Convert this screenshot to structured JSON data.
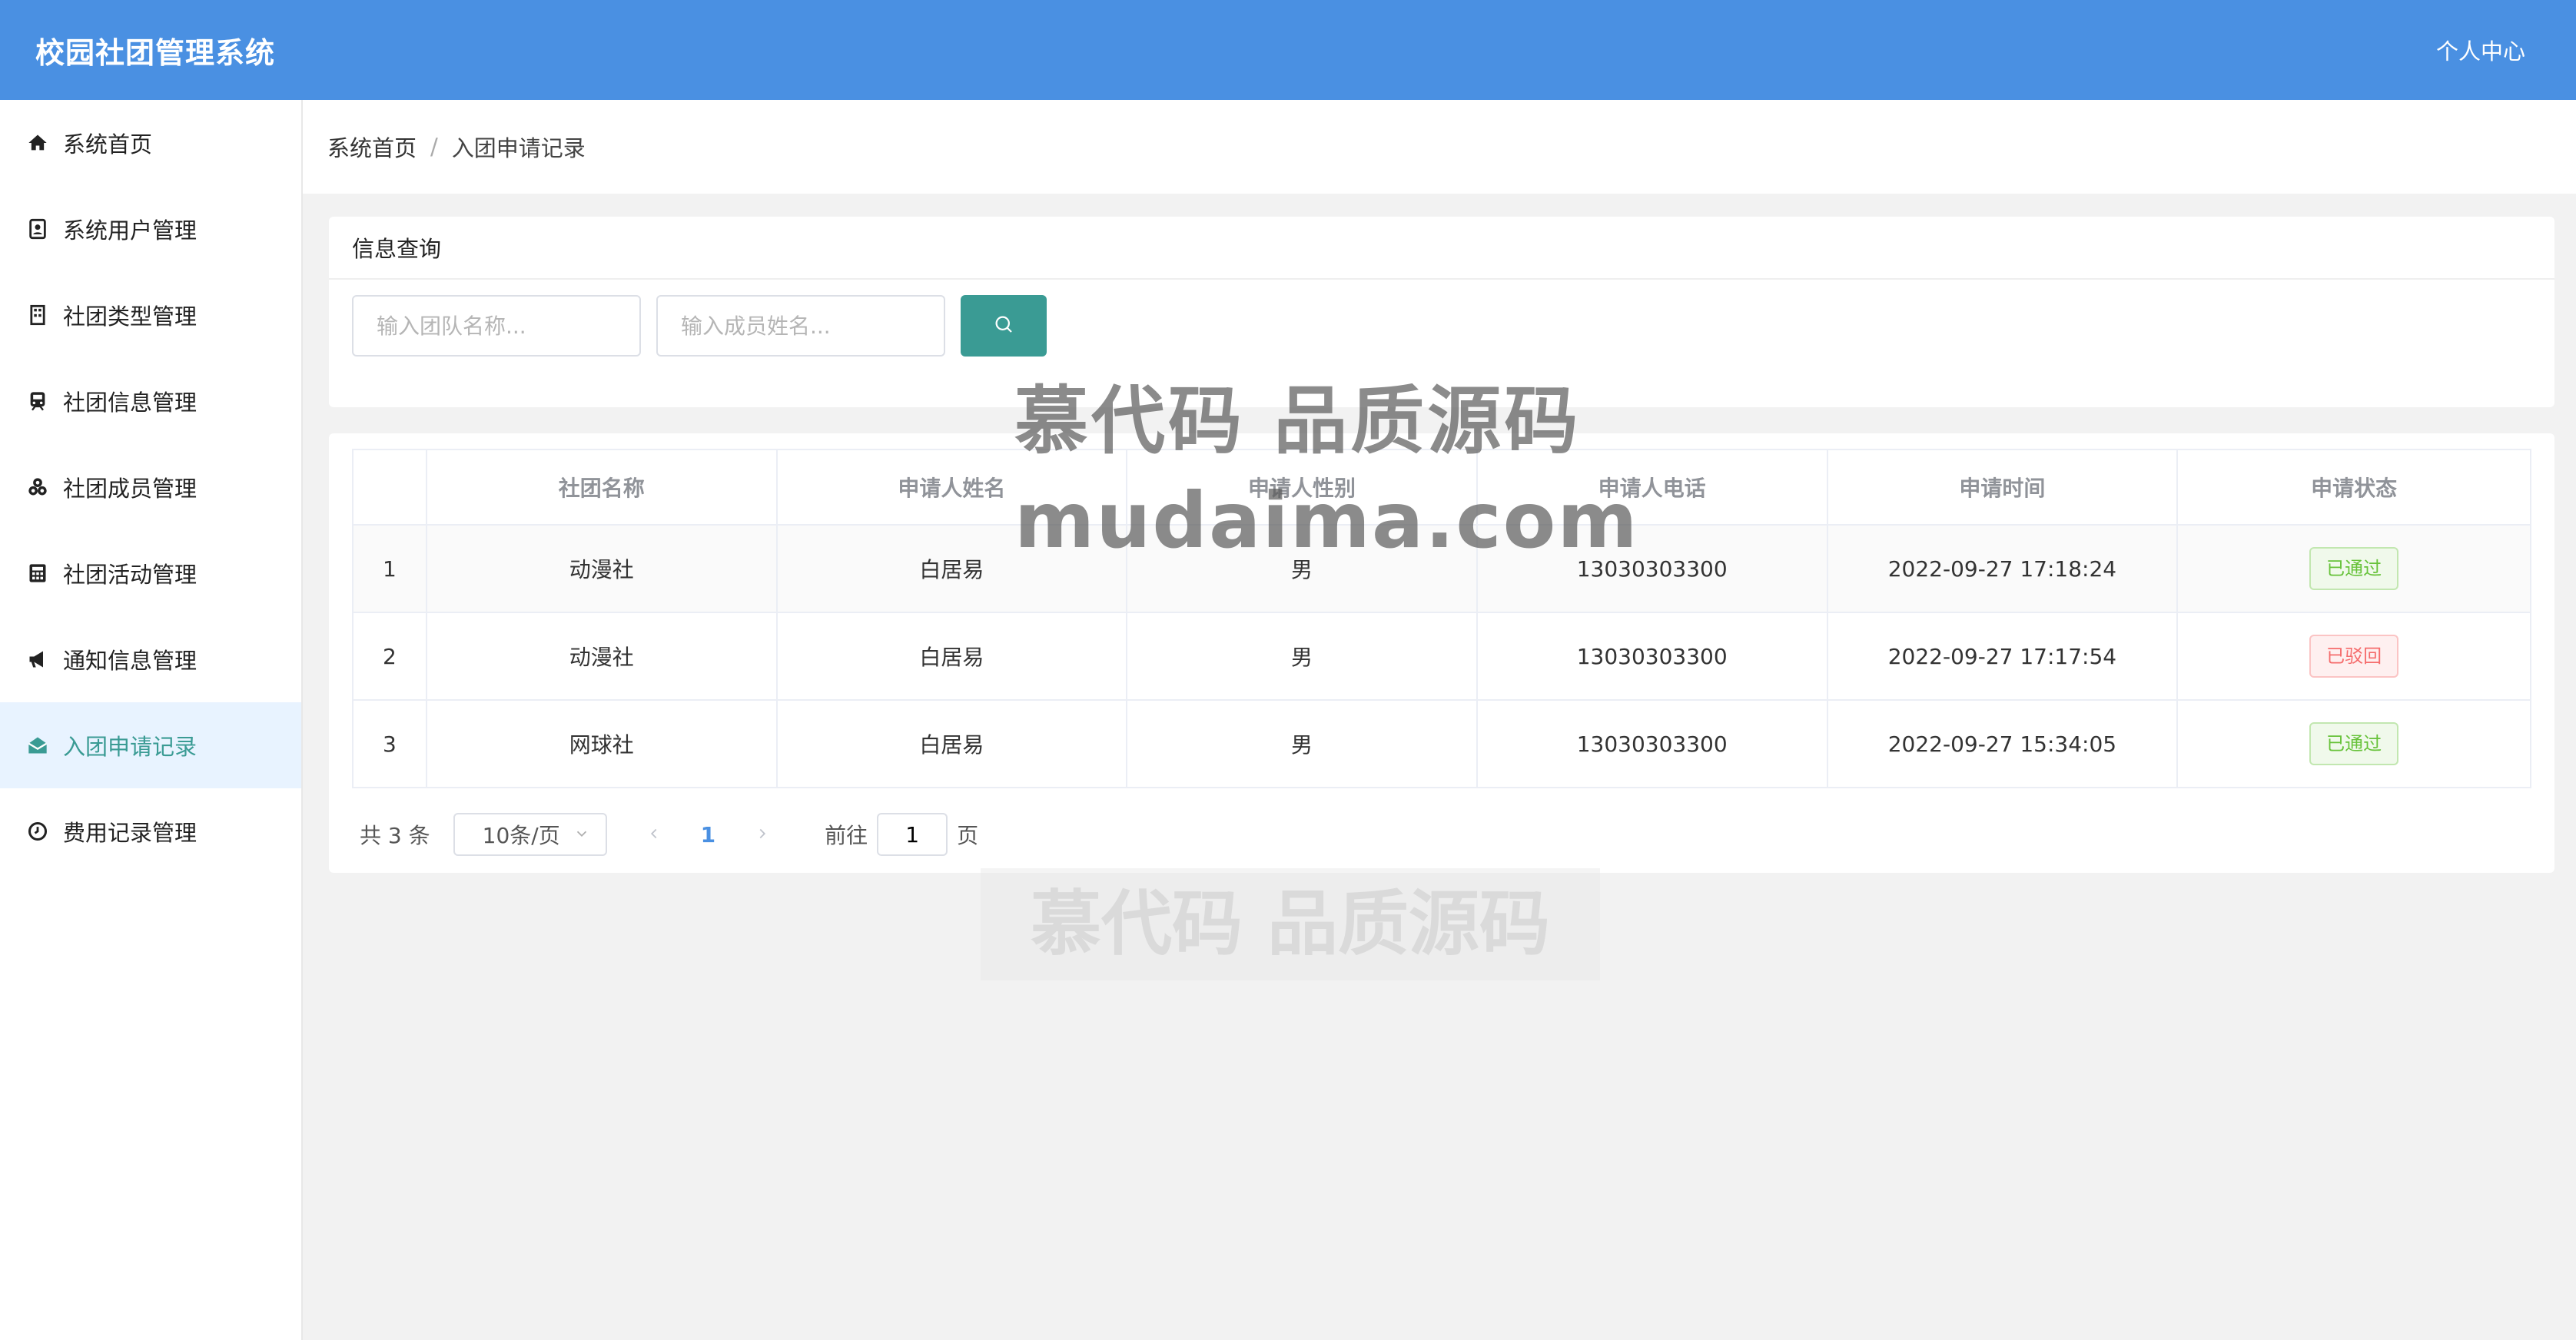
{
  "header": {
    "title": "校园社团管理系统",
    "user_menu": "个人中心"
  },
  "sidebar": {
    "items": [
      {
        "label": "系统首页",
        "icon": "home-icon"
      },
      {
        "label": "系统用户管理",
        "icon": "user-card-icon"
      },
      {
        "label": "社团类型管理",
        "icon": "building-icon"
      },
      {
        "label": "社团信息管理",
        "icon": "train-icon"
      },
      {
        "label": "社团成员管理",
        "icon": "users-icon"
      },
      {
        "label": "社团活动管理",
        "icon": "calculator-icon"
      },
      {
        "label": "通知信息管理",
        "icon": "megaphone-icon"
      },
      {
        "label": "入团申请记录",
        "icon": "envelope-open-icon",
        "active": true
      },
      {
        "label": "费用记录管理",
        "icon": "clock-icon"
      }
    ]
  },
  "breadcrumb": {
    "home": "系统首页",
    "separator": "/",
    "current": "入团申请记录"
  },
  "query": {
    "title": "信息查询",
    "team_placeholder": "输入团队名称...",
    "member_placeholder": "输入成员姓名...",
    "search_icon": "search-icon"
  },
  "table": {
    "headers": [
      "",
      "社团名称",
      "申请人姓名",
      "申请人性别",
      "申请人电话",
      "申请时间",
      "申请状态"
    ],
    "rows": [
      {
        "index": "1",
        "club": "动漫社",
        "name": "白居易",
        "gender": "男",
        "phone": "13030303300",
        "time": "2022-09-27 17:18:24",
        "status": "已通过"
      },
      {
        "index": "2",
        "club": "动漫社",
        "name": "白居易",
        "gender": "男",
        "phone": "13030303300",
        "time": "2022-09-27 17:17:54",
        "status": "已驳回"
      },
      {
        "index": "3",
        "club": "网球社",
        "name": "白居易",
        "gender": "男",
        "phone": "13030303300",
        "time": "2022-09-27 15:34:05",
        "status": "已通过"
      }
    ]
  },
  "pagination": {
    "total": "共 3 条",
    "page_size": "10条/页",
    "current_page": "1",
    "goto_prefix": "前往",
    "goto_value": "1",
    "goto_suffix": "页"
  },
  "watermark": {
    "line1": "慕代码 品质源码",
    "line2": "mudaima.com",
    "faint": "慕代码 品质源码"
  },
  "colors": {
    "header": "#4a90e2",
    "accent": "#3a9b94",
    "approved": "#67c23a",
    "rejected": "#f56c6c"
  }
}
